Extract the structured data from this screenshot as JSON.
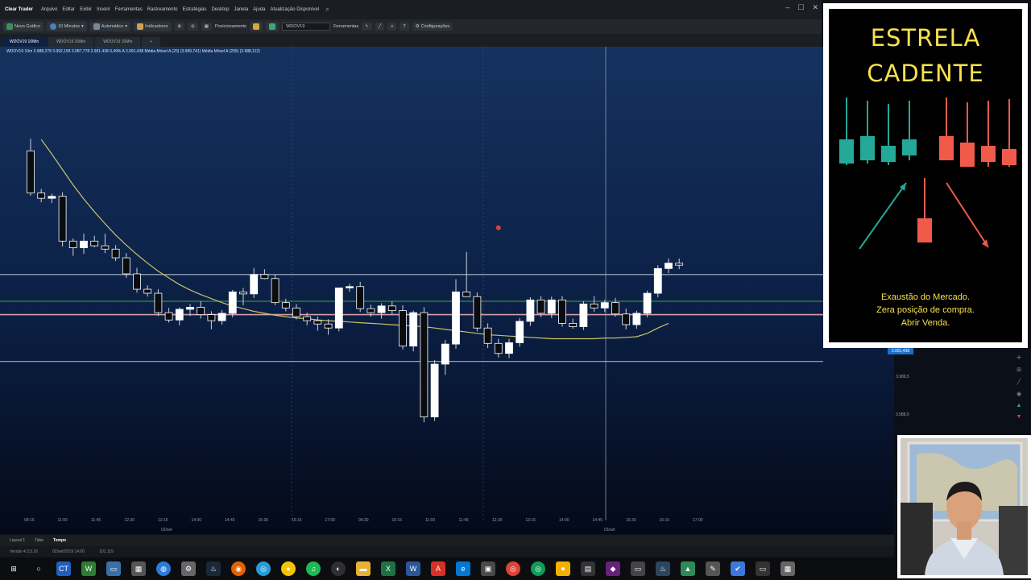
{
  "app": {
    "title": "Clear Trader",
    "menu": [
      "Arquivo",
      "Editar",
      "Exibir",
      "Inserir",
      "Ferramentas",
      "Rastreamento",
      "Estratégias",
      "Desktop",
      "Janela",
      "Ajuda",
      "Atualização Disponível"
    ]
  },
  "toolbar": {
    "new_chart": "Novo Gráfico",
    "interval": "10 Minutos",
    "mode": "Automático",
    "indicators": "Indicadores",
    "positioning_label": "Posicionamento",
    "symbol": "WDOV19",
    "tools_label": "Ferramentas",
    "settings": "Configurações"
  },
  "tabs": [
    {
      "label": "WDOV19 10Min",
      "active": true
    },
    {
      "label": "WDOV19 10Min",
      "active": false
    },
    {
      "label": "WDOV19 10Min",
      "active": false
    }
  ],
  "chart": {
    "info_line": "WDOV19 10m   3.988,278  3.992,158  3.987,778  3.991,438  0,49%   A  3.991,438   Média Móvel A (20)  (3.989,741)   Média Móvel A (200)  (3.988,112)",
    "session_labels": [
      "02/set",
      "03/set"
    ],
    "time_labels": [
      "09:15",
      "11:00",
      "11:45",
      "12:30",
      "13:15",
      "14:00",
      "14:45",
      "15:30",
      "16:15",
      "17:00",
      "09:30",
      "10:15",
      "11:00",
      "11:45",
      "12:30",
      "13:15",
      "14:00",
      "14:45",
      "15:30",
      "16:15",
      "17:00"
    ],
    "price_badge": "3.991,438",
    "price_ticks": [
      "3.989,5",
      "3.988,0"
    ],
    "up_color": "#ffffff",
    "down_color": "#0a0c10",
    "ma_color": "#c8c366",
    "level_colors": [
      "#a8b7c9",
      "#2f8f3c",
      "#d49ca7",
      "#9fb0c8"
    ]
  },
  "chart_data": {
    "type": "candlestick",
    "series": [
      {
        "o": 2.5,
        "h": 4.3,
        "l": -4.2,
        "c": -3.8
      },
      {
        "o": -3.8,
        "h": -3.2,
        "l": -5.2,
        "c": -4.6
      },
      {
        "o": -4.6,
        "h": -3.9,
        "l": -5.3,
        "c": -4.3
      },
      {
        "o": -4.3,
        "h": -3.7,
        "l": -11.8,
        "c": -11.0
      },
      {
        "o": -11.0,
        "h": -10.6,
        "l": -13.2,
        "c": -12.0
      },
      {
        "o": -12.0,
        "h": -9.9,
        "l": -12.9,
        "c": -11.0
      },
      {
        "o": -11.0,
        "h": -10.2,
        "l": -11.9,
        "c": -11.7
      },
      {
        "o": -11.7,
        "h": -9.9,
        "l": -12.8,
        "c": -12.2
      },
      {
        "o": -12.2,
        "h": -11.6,
        "l": -14.0,
        "c": -13.5
      },
      {
        "o": -13.5,
        "h": -12.8,
        "l": -16.5,
        "c": -15.9
      },
      {
        "o": -15.9,
        "h": -15.0,
        "l": -18.7,
        "c": -18.2
      },
      {
        "o": -18.2,
        "h": -17.6,
        "l": -19.3,
        "c": -18.8
      },
      {
        "o": -18.8,
        "h": -18.2,
        "l": -22.2,
        "c": -21.7
      },
      {
        "o": -21.7,
        "h": -21.0,
        "l": -23.2,
        "c": -22.8
      },
      {
        "o": -22.8,
        "h": -20.9,
        "l": -23.6,
        "c": -21.2
      },
      {
        "o": -21.2,
        "h": -20.4,
        "l": -22.2,
        "c": -20.9
      },
      {
        "o": -20.9,
        "h": -20.0,
        "l": -22.6,
        "c": -22.0
      },
      {
        "o": -22.0,
        "h": -21.5,
        "l": -24.2,
        "c": -22.9
      },
      {
        "o": -22.9,
        "h": -21.3,
        "l": -23.5,
        "c": -21.8
      },
      {
        "o": -21.8,
        "h": -18.3,
        "l": -22.4,
        "c": -18.6
      },
      {
        "o": -18.6,
        "h": -18.0,
        "l": -20.6,
        "c": -18.9
      },
      {
        "o": -18.9,
        "h": -15.0,
        "l": -19.5,
        "c": -16.0
      },
      {
        "o": -16.0,
        "h": -15.2,
        "l": -16.7,
        "c": -16.6
      },
      {
        "o": -16.6,
        "h": -16.0,
        "l": -20.6,
        "c": -20.2
      },
      {
        "o": -20.2,
        "h": -19.6,
        "l": -21.5,
        "c": -21.0
      },
      {
        "o": -21.0,
        "h": -20.4,
        "l": -22.7,
        "c": -22.3
      },
      {
        "o": -22.3,
        "h": -21.7,
        "l": -23.6,
        "c": -22.9
      },
      {
        "o": -22.9,
        "h": -22.3,
        "l": -24.4,
        "c": -23.4
      },
      {
        "o": -23.4,
        "h": -22.7,
        "l": -25.0,
        "c": -24.0
      },
      {
        "o": -24.0,
        "h": -19.4,
        "l": -24.5,
        "c": -18.0
      },
      {
        "o": -18.0,
        "h": -17.4,
        "l": -18.6,
        "c": -17.8
      },
      {
        "o": -17.8,
        "h": -17.1,
        "l": -21.6,
        "c": -21.1
      },
      {
        "o": -21.1,
        "h": -20.5,
        "l": -22.3,
        "c": -21.7
      },
      {
        "o": -21.7,
        "h": -20.3,
        "l": -22.6,
        "c": -20.7
      },
      {
        "o": -20.7,
        "h": -20.0,
        "l": -22.0,
        "c": -21.4
      },
      {
        "o": -21.4,
        "h": -20.6,
        "l": -27.2,
        "c": -26.7
      },
      {
        "o": -26.7,
        "h": -21.4,
        "l": -27.5,
        "c": -21.7
      },
      {
        "o": -21.7,
        "h": -20.9,
        "l": -38.1,
        "c": -37.3
      },
      {
        "o": -37.3,
        "h": -28.8,
        "l": -37.9,
        "c": -29.4
      },
      {
        "o": -29.4,
        "h": -25.8,
        "l": -31.0,
        "c": -26.4
      },
      {
        "o": -26.4,
        "h": -16.7,
        "l": -27.1,
        "c": -18.6
      },
      {
        "o": -18.6,
        "h": -12.6,
        "l": -19.2,
        "c": -19.3
      },
      {
        "o": -19.3,
        "h": -18.7,
        "l": -24.5,
        "c": -24.0
      },
      {
        "o": -24.0,
        "h": -23.3,
        "l": -27.0,
        "c": -26.3
      },
      {
        "o": -26.3,
        "h": -25.6,
        "l": -28.4,
        "c": -27.8
      },
      {
        "o": -27.8,
        "h": -25.6,
        "l": -28.5,
        "c": -26.2
      },
      {
        "o": -26.2,
        "h": -22.5,
        "l": -26.8,
        "c": -23.0
      },
      {
        "o": -23.0,
        "h": -19.4,
        "l": -23.7,
        "c": -19.8
      },
      {
        "o": -19.8,
        "h": -19.2,
        "l": -22.4,
        "c": -21.8
      },
      {
        "o": -21.8,
        "h": -19.3,
        "l": -22.5,
        "c": -19.8
      },
      {
        "o": -19.8,
        "h": -19.2,
        "l": -23.8,
        "c": -23.3
      },
      {
        "o": -23.3,
        "h": -22.6,
        "l": -24.1,
        "c": -23.8
      },
      {
        "o": -23.8,
        "h": -20.0,
        "l": -24.3,
        "c": -20.4
      },
      {
        "o": -20.4,
        "h": -19.2,
        "l": -21.6,
        "c": -21.0
      },
      {
        "o": -21.0,
        "h": -19.8,
        "l": -21.6,
        "c": -20.2
      },
      {
        "o": -20.2,
        "h": -19.5,
        "l": -22.3,
        "c": -21.9
      },
      {
        "o": -21.9,
        "h": -21.1,
        "l": -24.2,
        "c": -23.5
      },
      {
        "o": -23.5,
        "h": -21.4,
        "l": -24.1,
        "c": -21.8
      },
      {
        "o": -21.8,
        "h": -18.4,
        "l": -22.4,
        "c": -18.8
      },
      {
        "o": -18.8,
        "h": -14.6,
        "l": -19.4,
        "c": -15.1
      },
      {
        "o": -15.1,
        "h": -13.6,
        "l": -15.8,
        "c": -14.3
      },
      {
        "o": -14.3,
        "h": -13.6,
        "l": -15.2,
        "c": -14.6
      }
    ],
    "moving_average": [
      4.2,
      2.0,
      -0.3,
      -2.6,
      -4.7,
      -6.6,
      -8.4,
      -10.1,
      -11.6,
      -13.0,
      -14.3,
      -15.5,
      -16.5,
      -17.5,
      -18.3,
      -19.0,
      -19.6,
      -20.2,
      -20.7,
      -21.1,
      -21.5,
      -21.8,
      -22.1,
      -22.3,
      -22.5,
      -22.6,
      -22.8,
      -22.9,
      -23.0,
      -23.1,
      -23.2,
      -23.3,
      -23.4,
      -23.5,
      -23.6,
      -23.7,
      -23.8,
      -24.0,
      -24.2,
      -24.4,
      -24.6,
      -24.8,
      -25.0,
      -25.1,
      -25.2,
      -25.3,
      -25.4,
      -25.5,
      -25.6,
      -25.6,
      -25.6,
      -25.6,
      -25.6,
      -25.5,
      -25.5,
      -25.4,
      -25.3,
      -24.8,
      -24.0,
      -23.3
    ],
    "levels": [
      -16.0,
      -20.0,
      -22.0,
      -29.0
    ],
    "signal_marker": {
      "index": 44,
      "value": -9.0
    }
  },
  "overlay_card": {
    "title_line1": "ESTRELA",
    "title_line2": "CADENTE",
    "desc_line1": "Exaustão do Mercado.",
    "desc_line2": "Zera posição de compra.",
    "desc_line3": "Abrir Venda.",
    "green": "#24a898",
    "red": "#ef5a4a"
  },
  "bottom_tabs": [
    {
      "label": "Layout 1",
      "active": false
    },
    {
      "label": "Tabe",
      "active": false
    },
    {
      "label": "Tempo",
      "active": true
    }
  ],
  "status": [
    "Versão 4.3.5.16",
    "02/set/2019 14:00",
    "101.119"
  ]
}
